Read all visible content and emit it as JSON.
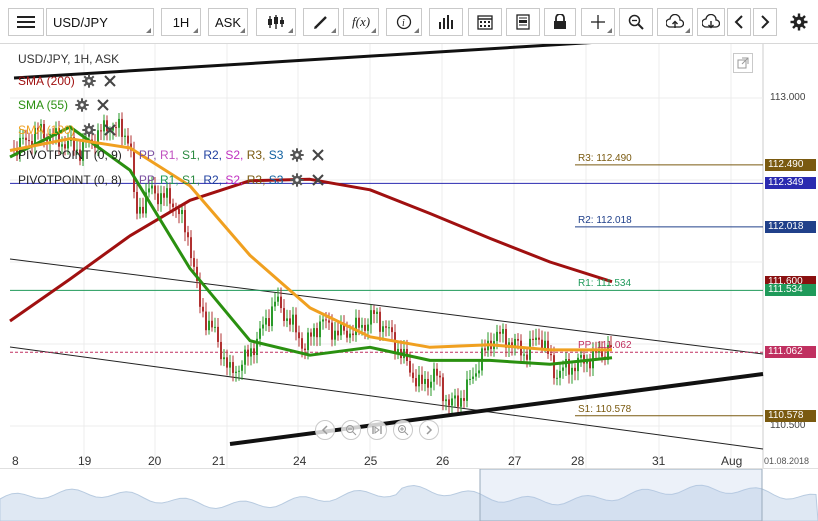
{
  "toolbar": {
    "symbol": "USD/JPY",
    "timeframe": "1H",
    "price_side": "ASK",
    "buttons": [
      "menu-icon",
      "candles-icon",
      "draw-icon",
      "function-icon",
      "info-icon",
      "bars-icon",
      "calendar-icon",
      "news-icon",
      "lock-icon",
      "crosshair-icon",
      "zoom-icon",
      "upload-icon",
      "download-icon",
      "prev-icon",
      "next-icon",
      "settings-icon"
    ]
  },
  "chart": {
    "title": "USD/JPY, 1H, ASK",
    "indicators": [
      {
        "label": "SMA (200)",
        "color": "#a01010"
      },
      {
        "label": "SMA (55)",
        "color": "#2a9010"
      },
      {
        "label": "SMA (100)",
        "color": "#f0a020"
      }
    ],
    "pivots": [
      {
        "label": "PIVOTPOINT (0, 9)",
        "parts": [
          "PP,",
          "R1,",
          "S1,",
          "R2,",
          "S2,",
          "R3,",
          "S3"
        ]
      },
      {
        "label": "PIVOTPOINT (0, 8)",
        "parts": [
          "PP,",
          "R1,",
          "S1,",
          "R2,",
          "S2,",
          "R3,",
          "S3"
        ]
      }
    ],
    "pivot_colors": [
      "#7a4fa0",
      "#c050c0",
      "#2a8a40",
      "#2040a0",
      "#c030c0",
      "#7a5a10",
      "#1060a0"
    ],
    "levels": [
      {
        "name": "R3: 112.490",
        "value": 112.49,
        "tag": "112.490",
        "color": "#7a5a10"
      },
      {
        "name": "",
        "value": 112.349,
        "tag": "112.349",
        "color": "#2a2ab0"
      },
      {
        "name": "R2: 112.018",
        "value": 112.018,
        "tag": "112.018",
        "color": "#20408a"
      },
      {
        "name": "",
        "value": 111.6,
        "tag": "111.600",
        "color": "#8a1010"
      },
      {
        "name": "R1: 111.534",
        "value": 111.534,
        "tag": "111.534",
        "color": "#1f9a5a"
      },
      {
        "name": "PP: 111.062",
        "value": 111.062,
        "tag": "111.062",
        "color": "#c03060"
      },
      {
        "name": "S1: 110.578",
        "value": 110.578,
        "tag": "110.578",
        "color": "#7a5a10"
      }
    ],
    "y_ticks": [
      "113.000",
      "110.500"
    ],
    "x_labels": [
      "8",
      "19",
      "20",
      "21",
      "24",
      "25",
      "26",
      "27",
      "28",
      "31",
      "Aug"
    ],
    "end_date": "01.08.2018"
  },
  "chart_data": {
    "type": "line",
    "title": "USD/JPY, 1H, ASK",
    "xlabel": "",
    "ylabel": "",
    "ylim": [
      110.3,
      113.3
    ],
    "series": [
      {
        "name": "SMA (200)",
        "values": [
          111.3,
          111.62,
          111.95,
          112.22,
          112.37,
          112.38,
          112.3,
          112.12,
          111.93,
          111.75,
          111.6
        ]
      },
      {
        "name": "SMA (55)",
        "values": [
          112.55,
          112.78,
          112.45,
          111.7,
          111.15,
          111.04,
          111.1,
          111.0,
          111.0,
          110.97,
          111.02
        ]
      },
      {
        "name": "SMA (100)",
        "values": [
          112.6,
          112.69,
          112.62,
          112.33,
          111.8,
          111.4,
          111.18,
          111.1,
          111.12,
          111.08,
          111.08
        ]
      }
    ]
  }
}
